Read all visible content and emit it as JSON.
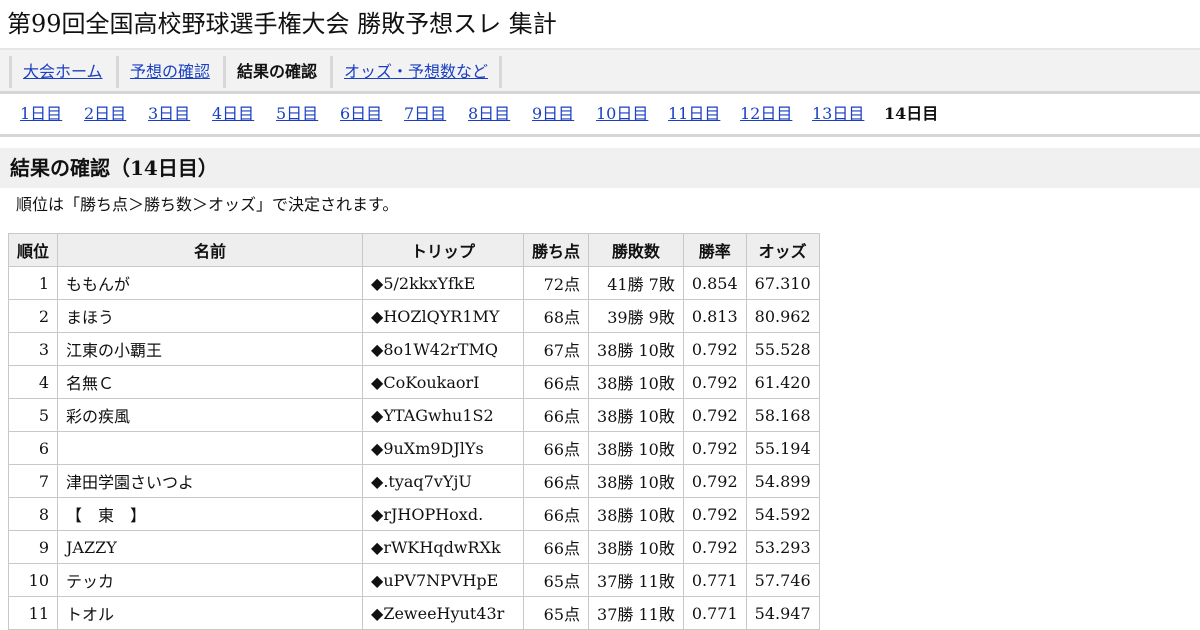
{
  "page": {
    "title": "第99回全国高校野球選手権大会 勝敗予想スレ 集計"
  },
  "nav_main": {
    "items": [
      {
        "label": "大会ホーム",
        "current": false
      },
      {
        "label": "予想の確認",
        "current": false
      },
      {
        "label": "結果の確認",
        "current": true
      },
      {
        "label": "オッズ・予想数など",
        "current": false
      }
    ]
  },
  "nav_days": {
    "items": [
      {
        "label": "1日目",
        "current": false
      },
      {
        "label": "2日目",
        "current": false
      },
      {
        "label": "3日目",
        "current": false
      },
      {
        "label": "4日目",
        "current": false
      },
      {
        "label": "5日目",
        "current": false
      },
      {
        "label": "6日目",
        "current": false
      },
      {
        "label": "7日目",
        "current": false
      },
      {
        "label": "8日目",
        "current": false
      },
      {
        "label": "9日目",
        "current": false
      },
      {
        "label": "10日目",
        "current": false
      },
      {
        "label": "11日目",
        "current": false
      },
      {
        "label": "12日目",
        "current": false
      },
      {
        "label": "13日目",
        "current": false
      },
      {
        "label": "14日目",
        "current": true
      }
    ]
  },
  "section": {
    "heading": "結果の確認（14日目）",
    "note": "順位は「勝ち点＞勝ち数＞オッズ」で決定されます。"
  },
  "table": {
    "headers": {
      "rank": "順位",
      "name": "名前",
      "trip": "トリップ",
      "points": "勝ち点",
      "win_loss": "勝敗数",
      "rate": "勝率",
      "odds": "オッズ"
    },
    "rows": [
      {
        "rank": "1",
        "name": "ももんが",
        "trip": "◆5/2kkxYfkE",
        "points": "72点",
        "win_loss": "41勝 7敗",
        "rate": "0.854",
        "odds": "67.310"
      },
      {
        "rank": "2",
        "name": "まほう",
        "trip": "◆HOZlQYR1MY",
        "points": "68点",
        "win_loss": "39勝 9敗",
        "rate": "0.813",
        "odds": "80.962"
      },
      {
        "rank": "3",
        "name": "江東の小覇王",
        "trip": "◆8o1W42rTMQ",
        "points": "67点",
        "win_loss": "38勝 10敗",
        "rate": "0.792",
        "odds": "55.528"
      },
      {
        "rank": "4",
        "name": "名無Ｃ",
        "trip": "◆CoKoukaorI",
        "points": "66点",
        "win_loss": "38勝 10敗",
        "rate": "0.792",
        "odds": "61.420"
      },
      {
        "rank": "5",
        "name": "彩の疾風",
        "trip": "◆YTAGwhu1S2",
        "points": "66点",
        "win_loss": "38勝 10敗",
        "rate": "0.792",
        "odds": "58.168"
      },
      {
        "rank": "6",
        "name": "",
        "trip": "◆9uXm9DJlYs",
        "points": "66点",
        "win_loss": "38勝 10敗",
        "rate": "0.792",
        "odds": "55.194"
      },
      {
        "rank": "7",
        "name": "津田学園さいつよ",
        "trip": "◆.tyaq7vYjU",
        "points": "66点",
        "win_loss": "38勝 10敗",
        "rate": "0.792",
        "odds": "54.899"
      },
      {
        "rank": "8",
        "name": "【　東　】",
        "trip": "◆rJHOPHoxd.",
        "points": "66点",
        "win_loss": "38勝 10敗",
        "rate": "0.792",
        "odds": "54.592"
      },
      {
        "rank": "9",
        "name": "JAZZY",
        "trip": "◆rWKHqdwRXk",
        "points": "66点",
        "win_loss": "38勝 10敗",
        "rate": "0.792",
        "odds": "53.293"
      },
      {
        "rank": "10",
        "name": "テッカ",
        "trip": "◆uPV7NPVHpE",
        "points": "65点",
        "win_loss": "37勝 11敗",
        "rate": "0.771",
        "odds": "57.746"
      },
      {
        "rank": "11",
        "name": "トオル",
        "trip": "◆ZeweeHyut43r",
        "points": "65点",
        "win_loss": "37勝 11敗",
        "rate": "0.771",
        "odds": "54.947"
      }
    ]
  }
}
